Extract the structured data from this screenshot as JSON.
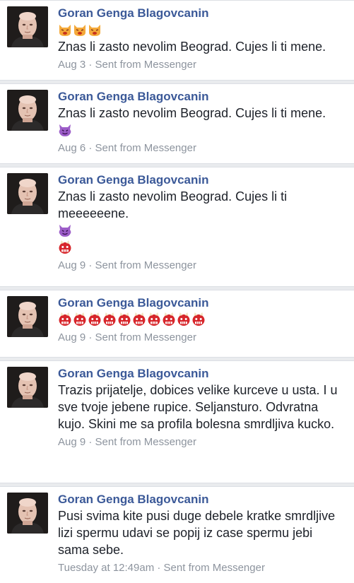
{
  "posts": [
    {
      "author": "Goran Genga Blagovcanin",
      "emoji_before": [
        "cat-face-icon",
        "cat-face-icon",
        "cat-face-icon"
      ],
      "text": "Znas li zasto nevolim Beograd. Cujes li ti mene.",
      "emoji_after": [],
      "date": "Aug 3",
      "separator": " · ",
      "source": "Sent from Messenger"
    },
    {
      "author": "Goran Genga Blagovcanin",
      "emoji_before": [],
      "text": "Znas li zasto nevolim Beograd. Cujes li ti mene.",
      "emoji_after": [
        "purple-devil-icon"
      ],
      "date": "Aug 6",
      "separator": " · ",
      "source": "Sent from Messenger"
    },
    {
      "author": "Goran Genga Blagovcanin",
      "emoji_before": [],
      "text": "Znas li zasto nevolim Beograd. Cujes li ti meeeeeene.",
      "emoji_after": [
        "purple-devil-icon",
        "red-ogre-icon"
      ],
      "date": "Aug 9",
      "separator": " · ",
      "source": "Sent from Messenger"
    },
    {
      "author": "Goran Genga Blagovcanin",
      "emoji_before": [
        "red-ogre-icon",
        "red-ogre-icon",
        "red-ogre-icon",
        "red-ogre-icon",
        "red-ogre-icon",
        "red-ogre-icon",
        "red-ogre-icon",
        "red-ogre-icon",
        "red-ogre-icon",
        "red-ogre-icon"
      ],
      "text": "",
      "emoji_after": [],
      "date": "Aug 9",
      "separator": " · ",
      "source": "Sent from Messenger"
    },
    {
      "author": "Goran Genga Blagovcanin",
      "emoji_before": [],
      "text": "Trazis prijatelje, dobices velike kurceve u usta. I u sve tvoje jebene rupice. Seljansturo. Odvratna kujo. Skini me sa profila bolesna smrdljiva kucko.",
      "emoji_after": [],
      "date": "Aug 9",
      "separator": " · ",
      "source": "Sent from Messenger"
    },
    {
      "author": "Goran Genga Blagovcanin",
      "emoji_before": [],
      "text": "Pusi svima kite pusi duge debele kratke smrdljive lizi spermu udavi se popij iz case spermu jebi sama sebe.",
      "emoji_after": [],
      "date": "Tuesday at 12:49am",
      "separator": " · ",
      "source": "Sent from Messenger"
    }
  ],
  "colors": {
    "author": "#3b5998",
    "text": "#1d2129",
    "meta": "#8d949e",
    "background": "#e9ebee"
  }
}
